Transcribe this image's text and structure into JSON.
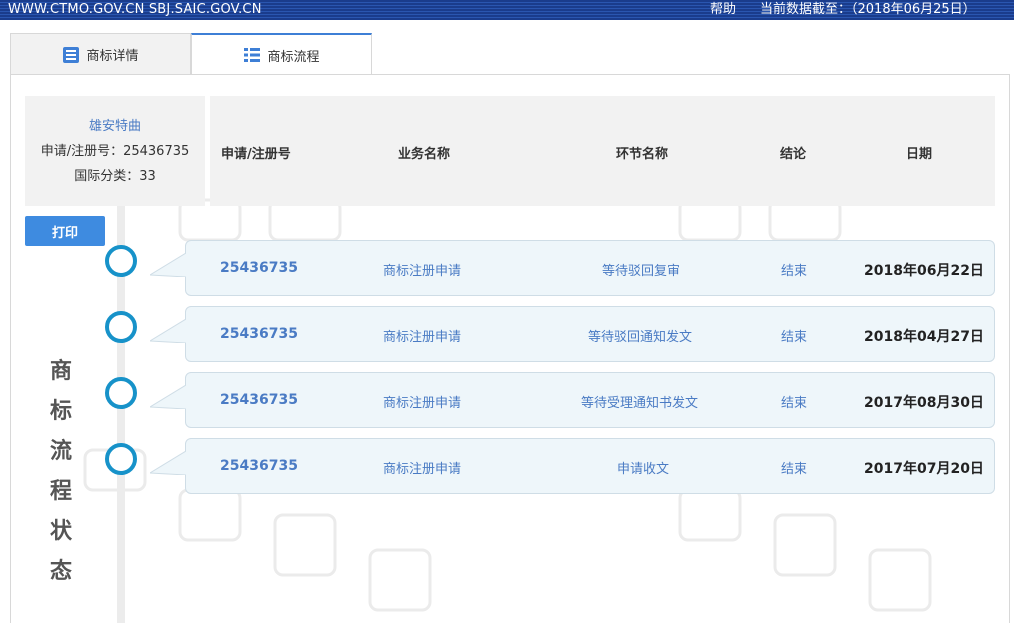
{
  "topbar": {
    "site": "WWW.CTMO.GOV.CN SBJ.SAIC.GOV.CN",
    "help": "帮助",
    "data_date": "当前数据截至：（2018年06月25日）"
  },
  "tabs": [
    {
      "label": "商标详情",
      "icon": "document-list-icon"
    },
    {
      "label": "商标流程",
      "icon": "list-icon"
    }
  ],
  "info": {
    "name": "雄安特曲",
    "reg_no": "申请/注册号：25436735",
    "intl_class": "国际分类：33"
  },
  "columns": [
    "申请/注册号",
    "业务名称",
    "环节名称",
    "结论",
    "日期"
  ],
  "print_label": "打印",
  "side_title": [
    "商",
    "标",
    "流",
    "程",
    "状",
    "态"
  ],
  "rows": [
    {
      "reg_no": "25436735",
      "business": "商标注册申请",
      "step": "等待驳回复审",
      "result": "结束",
      "date": "2018年06月22日"
    },
    {
      "reg_no": "25436735",
      "business": "商标注册申请",
      "step": "等待驳回通知发文",
      "result": "结束",
      "date": "2018年04月27日"
    },
    {
      "reg_no": "25436735",
      "business": "商标注册申请",
      "step": "等待受理通知书发文",
      "result": "结束",
      "date": "2017年08月30日"
    },
    {
      "reg_no": "25436735",
      "business": "商标注册申请",
      "step": "申请收文",
      "result": "结束",
      "date": "2017年07月20日"
    }
  ],
  "colors": {
    "accent": "#3e8be0",
    "link": "#4a7bc4",
    "timeline": "#1792c9",
    "row_bg": "#eef6fa",
    "topbar": "#1a3c8c"
  }
}
